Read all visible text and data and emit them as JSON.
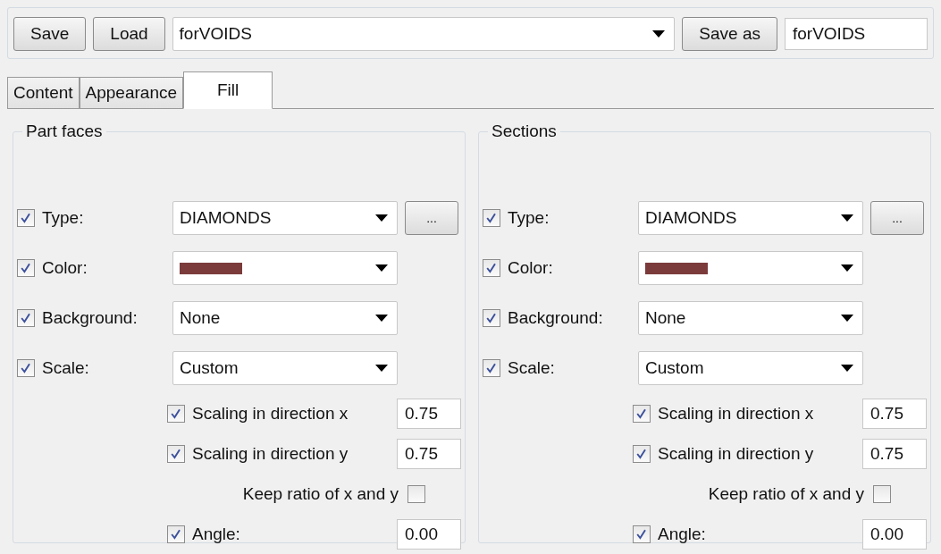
{
  "toolbar": {
    "save_button": "Save",
    "load_button": "Load",
    "preset_dropdown": {
      "value": "forVOIDS"
    },
    "save_as_button": "Save as",
    "save_as_field": {
      "value": "forVOIDS"
    }
  },
  "tabs": [
    {
      "label": "Content",
      "selected": false
    },
    {
      "label": "Appearance",
      "selected": false
    },
    {
      "label": "Fill",
      "selected": true
    }
  ],
  "panels": [
    {
      "title": "Part faces",
      "rows": [
        {
          "kind": "text",
          "label": "Type:",
          "checked": true,
          "value": "DIAMONDS",
          "more_button": "..."
        },
        {
          "kind": "color",
          "label": "Color:",
          "checked": true,
          "color": "#7b3b3b"
        },
        {
          "kind": "text",
          "label": "Background:",
          "checked": true,
          "value": "None"
        },
        {
          "kind": "text",
          "label": "Scale:",
          "checked": true,
          "value": "Custom"
        }
      ],
      "scaling": [
        {
          "label": "Scaling in direction x",
          "checked": true,
          "value": "0.75"
        },
        {
          "label": "Scaling in direction y",
          "checked": true,
          "value": "0.75"
        }
      ],
      "keep_ratio": {
        "label": "Keep ratio of x and y",
        "checked": false
      },
      "angle": {
        "label": "Angle:",
        "checked": true,
        "value": "0.00"
      }
    },
    {
      "title": "Sections",
      "rows": [
        {
          "kind": "text",
          "label": "Type:",
          "checked": true,
          "value": "DIAMONDS",
          "more_button": "..."
        },
        {
          "kind": "color",
          "label": "Color:",
          "checked": true,
          "color": "#7b3b3b"
        },
        {
          "kind": "text",
          "label": "Background:",
          "checked": true,
          "value": "None"
        },
        {
          "kind": "text",
          "label": "Scale:",
          "checked": true,
          "value": "Custom"
        }
      ],
      "scaling": [
        {
          "label": "Scaling in direction x",
          "checked": true,
          "value": "0.75"
        },
        {
          "label": "Scaling in direction y",
          "checked": true,
          "value": "0.75"
        }
      ],
      "keep_ratio": {
        "label": "Keep ratio of x and y",
        "checked": false
      },
      "angle": {
        "label": "Angle:",
        "checked": true,
        "value": "0.00"
      }
    }
  ]
}
